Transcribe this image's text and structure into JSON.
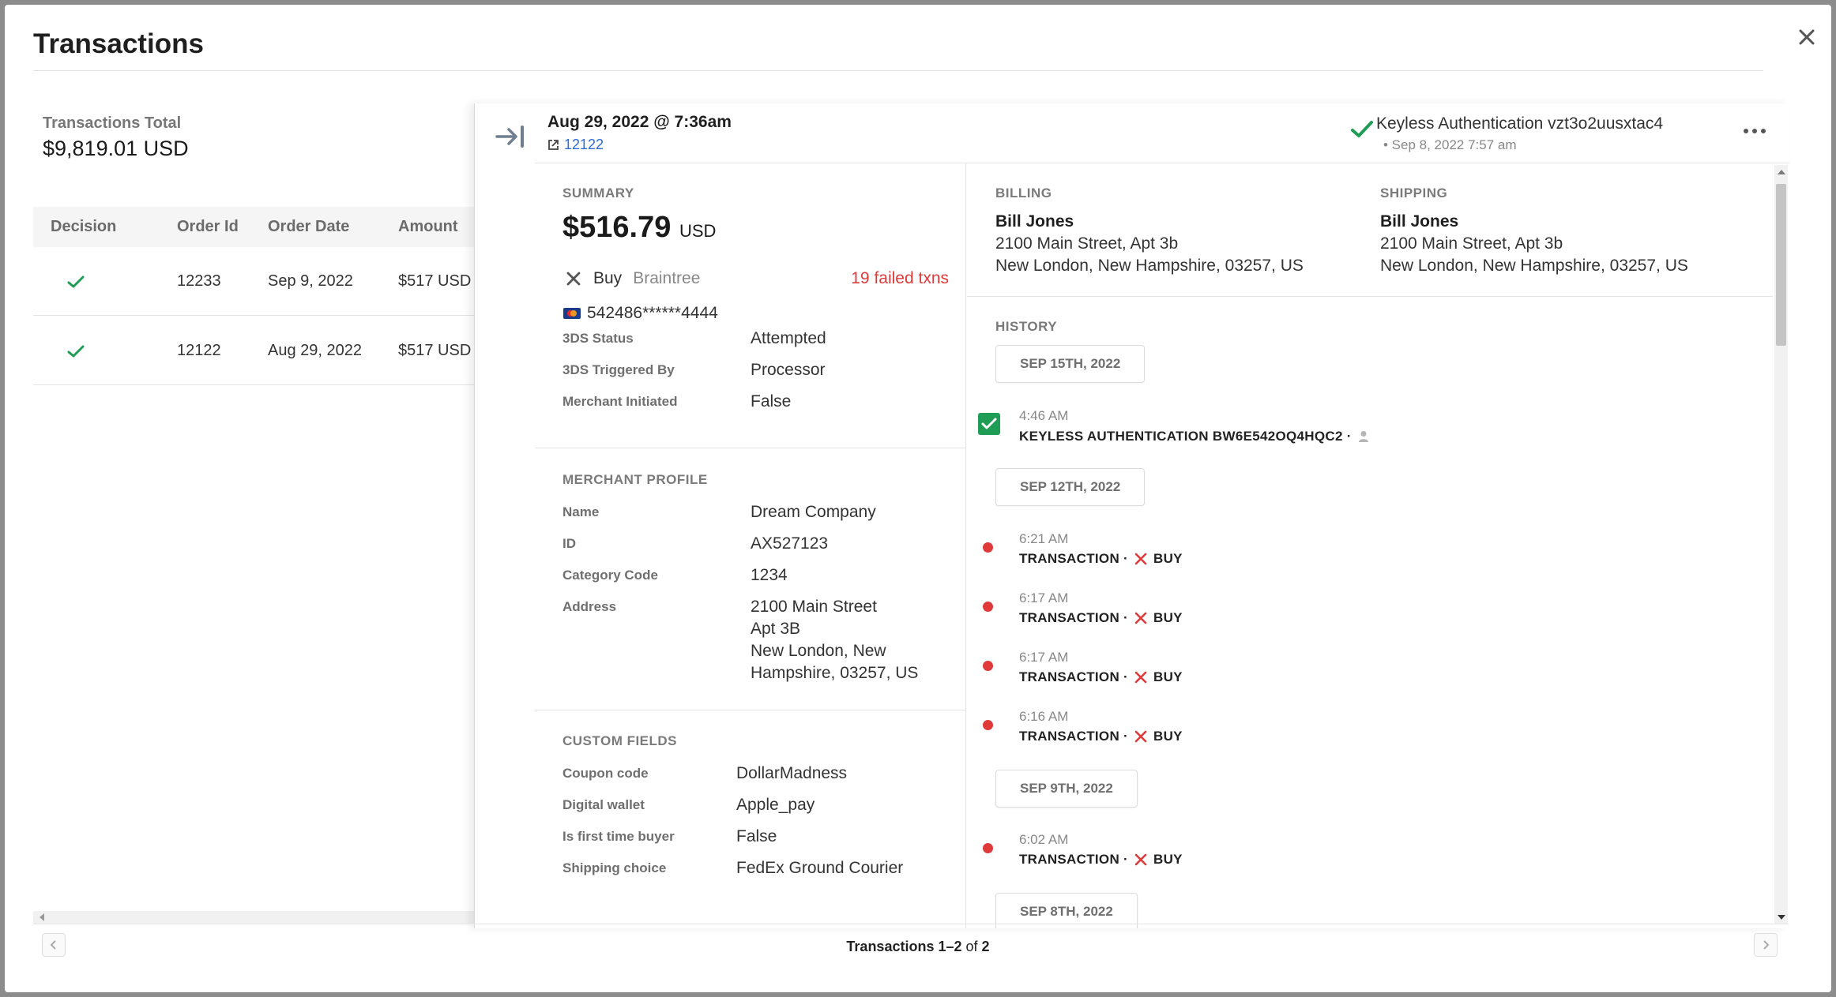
{
  "modal": {
    "title": "Transactions"
  },
  "list": {
    "total_label": "Transactions Total",
    "total_value": "$9,819.01 USD",
    "columns": {
      "decision": "Decision",
      "order_id": "Order Id",
      "order_date": "Order Date",
      "amount": "Amount"
    },
    "rows": [
      {
        "order_id": "12233",
        "order_date": "Sep 9, 2022",
        "amount": "$517 USD"
      },
      {
        "order_id": "12122",
        "order_date": "Aug 29, 2022",
        "amount": "$517 USD"
      }
    ]
  },
  "detail": {
    "date": "Aug 29, 2022 @ 7:36am",
    "order_link": "12122",
    "auth_title": "Keyless Authentication vzt3o2uusxtac4",
    "auth_sub": "• Sep 8, 2022 7:57 am",
    "summary": {
      "label": "SUMMARY",
      "amount": "$516.79",
      "currency": "USD",
      "type": "Buy",
      "gateway": "Braintree",
      "failed": "19 failed txns",
      "card": "542486******4444",
      "fields": [
        {
          "label": "3DS Status",
          "value": "Attempted"
        },
        {
          "label": "3DS Triggered By",
          "value": "Processor"
        },
        {
          "label": "Merchant Initiated",
          "value": "False"
        }
      ]
    },
    "merchant": {
      "label": "MERCHANT PROFILE",
      "name_label": "Name",
      "name": "Dream Company",
      "id_label": "ID",
      "id": "AX527123",
      "category_label": "Category Code",
      "category": "1234",
      "address_label": "Address",
      "address_lines": [
        "2100 Main Street",
        "Apt 3B",
        "New London, New",
        "Hampshire, 03257, US"
      ]
    },
    "custom": {
      "label": "CUSTOM FIELDS",
      "fields": [
        {
          "label": "Coupon code",
          "value": "DollarMadness"
        },
        {
          "label": "Digital wallet",
          "value": "Apple_pay"
        },
        {
          "label": "Is first time buyer",
          "value": "False"
        },
        {
          "label": "Shipping choice",
          "value": "FedEx Ground Courier"
        }
      ]
    },
    "billing": {
      "label": "BILLING",
      "name": "Bill Jones",
      "line1": "2100 Main Street, Apt 3b",
      "line2": "New London, New Hampshire, 03257, US"
    },
    "shipping": {
      "label": "SHIPPING",
      "name": "Bill Jones",
      "line1": "2100 Main Street, Apt 3b",
      "line2": "New London, New Hampshire, 03257, US"
    },
    "history": {
      "label": "HISTORY",
      "groups": [
        {
          "date": "SEP 15TH, 2022"
        },
        {
          "date": "SEP 12TH, 2022"
        },
        {
          "date": "SEP 9TH, 2022"
        },
        {
          "date": "SEP 8TH, 2022"
        }
      ],
      "keyless_event": {
        "time": "4:46 AM",
        "text": "KEYLESS AUTHENTICATION BW6E542OQ4HQC2 ·"
      },
      "events": [
        {
          "time": "6:21 AM",
          "text": "TRANSACTION ·",
          "action": "BUY"
        },
        {
          "time": "6:17 AM",
          "text": "TRANSACTION ·",
          "action": "BUY"
        },
        {
          "time": "6:17 AM",
          "text": "TRANSACTION ·",
          "action": "BUY"
        },
        {
          "time": "6:16 AM",
          "text": "TRANSACTION ·",
          "action": "BUY"
        },
        {
          "time": "6:02 AM",
          "text": "TRANSACTION ·",
          "action": "BUY"
        }
      ]
    }
  },
  "pager": {
    "range": "Transactions 1–2",
    "of": "of",
    "total": "2"
  },
  "colors": {
    "green": "#1f9d55",
    "red": "#e0393a",
    "link": "#2e6bd8"
  }
}
